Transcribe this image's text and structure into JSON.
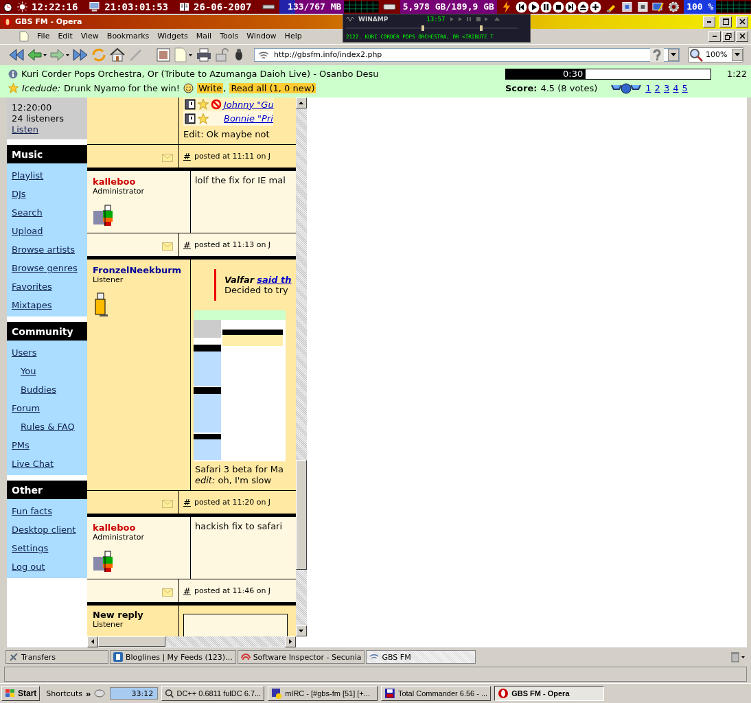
{
  "system_bar": {
    "time": "12:22:16",
    "uptime": "21:03:01:53",
    "date": "26-06-2007",
    "memory": "133/767 MB",
    "disk": "5,978 GB/189,9 GB",
    "volume": "100 %"
  },
  "winamp": {
    "title": "WINAMP",
    "time": "13:57",
    "marquee": "2122. KURI CORDER POPS ORCHESTRA, OR <TRIBUTE T"
  },
  "window": {
    "title": "GBS FM - Opera"
  },
  "menu": [
    "File",
    "Edit",
    "View",
    "Bookmarks",
    "Widgets",
    "Mail",
    "Tools",
    "Window",
    "Help"
  ],
  "address": {
    "value": "http://gbsfm.info/index2.php"
  },
  "zoom": {
    "value": "100%"
  },
  "now_playing": {
    "track": "Kuri Corder Pops Orchestra, Or (Tribute to Azumanga Daioh Live) - Osanbo Desu",
    "elapsed": "0:30",
    "level": 0.39,
    "duration": "1:22",
    "shout": {
      "user": "Icedude:",
      "message": "Drunk Nyamo for the win!",
      "write": "Write",
      "separator": ",",
      "read_all": "Read all (1, 0 new)"
    },
    "score_label": "Score:",
    "score": "4.5 (8 votes)",
    "ratings": [
      "1",
      "2",
      "3",
      "4",
      "5"
    ]
  },
  "station": {
    "time": "12:20:00",
    "listeners": "24 listeners",
    "listen": "Listen"
  },
  "sidebar": [
    {
      "title": "Music",
      "items": [
        {
          "label": "Playlist"
        },
        {
          "label": "DJs"
        },
        {
          "label": "Search"
        },
        {
          "label": "Upload"
        },
        {
          "label": "Browse artists"
        },
        {
          "label": "Browse genres"
        },
        {
          "label": "Favorites"
        },
        {
          "label": "Mixtapes"
        }
      ]
    },
    {
      "title": "Community",
      "items": [
        {
          "label": "Users",
          "children": [
            {
              "label": "You"
            },
            {
              "label": "Buddies"
            }
          ]
        },
        {
          "label": "Forum",
          "children": [
            {
              "label": "Rules & FAQ"
            }
          ]
        },
        {
          "label": "PMs"
        },
        {
          "label": "Live Chat"
        }
      ]
    },
    {
      "title": "Other",
      "items": [
        {
          "label": "Fun facts"
        },
        {
          "label": "Desktop client"
        },
        {
          "label": "Settings"
        },
        {
          "label": "Log out"
        }
      ]
    }
  ],
  "posts": [
    {
      "kind": "fragment",
      "items": [
        {
          "text": "Johnny \"Gu",
          "blocked": true
        },
        {
          "text": "Bonnie \"Pri",
          "blocked": false
        }
      ],
      "body": "Edit: Ok maybe not",
      "permalink": "#",
      "footer": "posted at 11:11 on J"
    },
    {
      "kind": "post",
      "author": "kalleboo",
      "color": "#cc0000",
      "role": "Administrator",
      "avatar": {
        "kind": "rainbow"
      },
      "body": "lolf the fix for IE mal",
      "permalink": "#",
      "footer": "posted at 11:13 on J"
    },
    {
      "kind": "post",
      "author": "FronzelNeekburm",
      "color": "#000099",
      "role": "Listener",
      "avatar": {
        "kind": "yellow"
      },
      "quote": {
        "author": "Valfar",
        "link": "said th",
        "text": "Decided to try"
      },
      "screenshot": true,
      "body": "Safari 3 beta for Ma",
      "edit": {
        "label": "edit:",
        "text": "oh, I'm slow"
      },
      "permalink": "#",
      "footer": "posted at 11:20 on J"
    },
    {
      "kind": "post",
      "author": "kalleboo",
      "color": "#cc0000",
      "role": "Administrator",
      "avatar": {
        "kind": "rainbow"
      },
      "body": "hackish fix to safari",
      "permalink": "#",
      "footer": "posted at 11:46 on J"
    },
    {
      "kind": "reply",
      "author": "New reply",
      "role": "Listener"
    }
  ],
  "tabs": [
    {
      "label": "Transfers",
      "selected": false
    },
    {
      "label": "Bloglines | My Feeds (123)...",
      "selected": false
    },
    {
      "label": "Software Inspector - Secunia",
      "selected": false
    },
    {
      "label": "GBS FM",
      "selected": true
    }
  ],
  "taskbar": {
    "start": "Start",
    "shortcuts": "Shortcuts",
    "chevron": "»",
    "timer": "33:12",
    "tasks": [
      {
        "label": "DC++ 0.6811 fulDC 6.7...",
        "selected": false
      },
      {
        "label": "mIRC - [#gbs-fm [51] [+...",
        "selected": false
      },
      {
        "label": "Total Commander 6.56 - ...",
        "selected": false
      },
      {
        "label": "GBS FM - Opera",
        "selected": true
      }
    ]
  }
}
